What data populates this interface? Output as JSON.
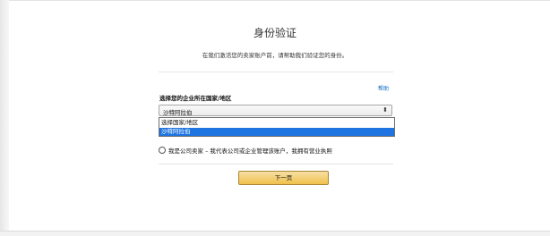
{
  "page": {
    "title": "身份验证",
    "subtitle": "在我们激活您的卖家账户前，请帮助我们验证您的身份。"
  },
  "help_link": "帮助",
  "country": {
    "label": "选择您的企业所在国家/地区",
    "selected_value": "沙特阿拉伯",
    "options": [
      "选择国家/地区",
      "沙特阿拉伯"
    ],
    "highlighted_index": 1
  },
  "business_radio": {
    "label": "我是公司卖家 – 我代表公司或企业管理该账户，我拥有营业执照",
    "checked": false
  },
  "next_button": "下一页",
  "colors": {
    "link": "#0066c0",
    "highlight": "#1e74e0",
    "button": "#f0c14b"
  }
}
